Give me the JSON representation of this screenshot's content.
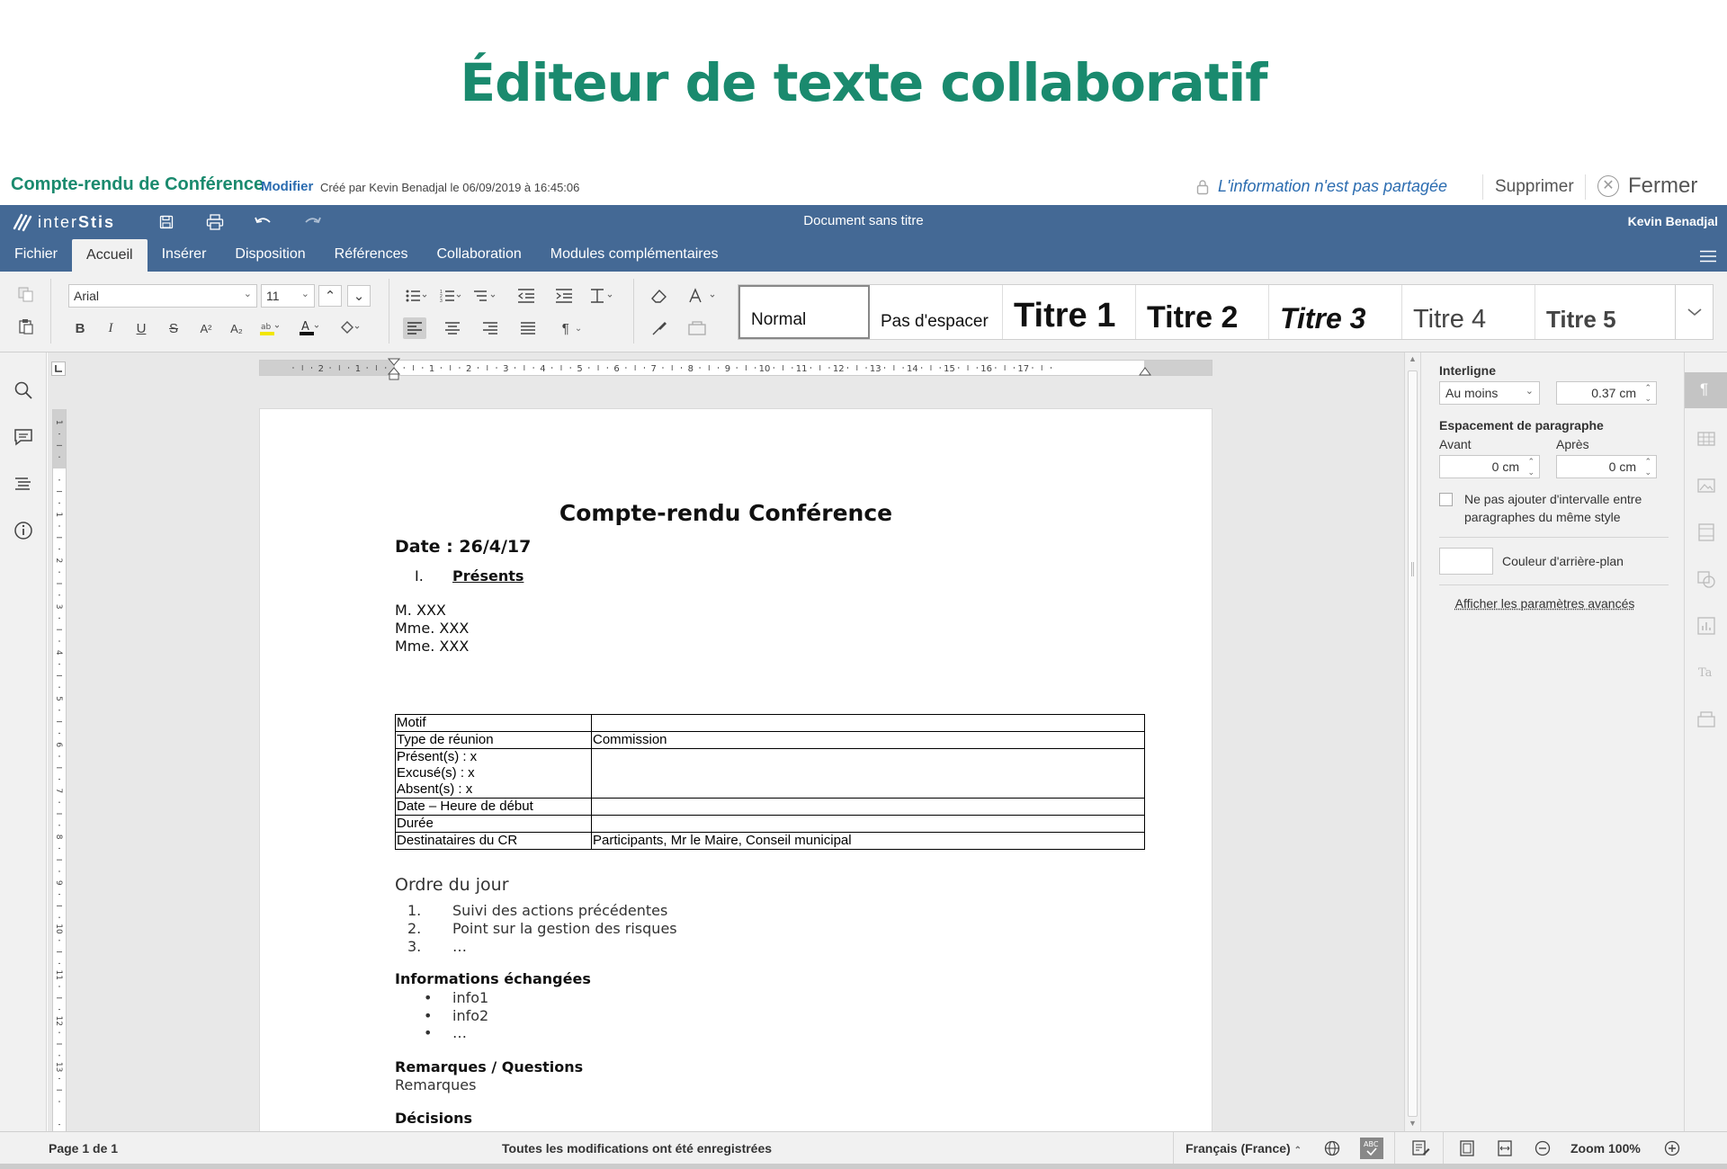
{
  "banner": {
    "title": "Éditeur de texte collaboratif"
  },
  "docbar": {
    "title": "Compte-rendu de Conférence",
    "edit_label": "Modifier",
    "created": "Créé par Kevin Benadjal le 06/09/2019 à 16:45:06",
    "sharing": "L'information n'est pas partagée",
    "delete_label": "Supprimer",
    "close_label": "Fermer"
  },
  "header": {
    "brand_prefix": "inter",
    "brand_suffix": "Stis",
    "doc_name": "Document sans titre",
    "user": "Kevin Benadjal",
    "tabs": [
      {
        "label": "Fichier"
      },
      {
        "label": "Accueil"
      },
      {
        "label": "Insérer"
      },
      {
        "label": "Disposition"
      },
      {
        "label": "Références"
      },
      {
        "label": "Collaboration"
      },
      {
        "label": "Modules complémentaires"
      }
    ]
  },
  "toolbar": {
    "font_family": "Arial",
    "font_size": "11",
    "styles": [
      {
        "label": "Normal"
      },
      {
        "label": "Pas d'espacer"
      },
      {
        "label": "Titre 1"
      },
      {
        "label": "Titre 2"
      },
      {
        "label": "Titre 3"
      },
      {
        "label": "Titre 4"
      },
      {
        "label": "Titre 5"
      }
    ]
  },
  "ruler": {
    "h_labels": [
      "2",
      "1",
      "1",
      "2",
      "3",
      "4",
      "5",
      "6",
      "7",
      "8",
      "9",
      "10",
      "11",
      "12",
      "13",
      "14",
      "15",
      "16",
      "17"
    ],
    "v_labels": [
      "1",
      "1",
      "2",
      "3",
      "4",
      "5",
      "6",
      "7",
      "8",
      "9",
      "10",
      "11",
      "12",
      "13"
    ]
  },
  "document": {
    "title": "Compte-rendu Conférence",
    "date": "Date :  26/4/17",
    "section1_num": "I.",
    "section1": "Présents",
    "attendees": [
      "M. XXX",
      "Mme. XXX",
      "Mme. XXX"
    ],
    "table": [
      {
        "label": "Motif",
        "value": ""
      },
      {
        "label": "Type de réunion",
        "value": "Commission"
      },
      {
        "label": "Présent(s) : x\nExcusé(s) : x\nAbsent(s) : x",
        "value": ""
      },
      {
        "label": "Date – Heure de début",
        "value": ""
      },
      {
        "label": "Durée",
        "value": ""
      },
      {
        "label": "Destinataires du CR",
        "value": "Participants, Mr le Maire, Conseil municipal"
      }
    ],
    "agenda_title": "Ordre du jour",
    "agenda": [
      {
        "num": "1.",
        "text": "Suivi des actions précédentes"
      },
      {
        "num": "2.",
        "text": "Point sur la gestion des risques"
      },
      {
        "num": "3.",
        "text": "…"
      }
    ],
    "info_title": "Informations échangées",
    "info": [
      "info1",
      "info2",
      "…"
    ],
    "remarks_title": "Remarques / Questions",
    "remarks": "Remarques",
    "decisions_title": "Décisions"
  },
  "panel": {
    "line_spacing_label": "Interligne",
    "line_spacing_mode": "Au moins",
    "line_spacing_value": "0.37 cm",
    "para_spacing_label": "Espacement de paragraphe",
    "before_label": "Avant",
    "after_label": "Après",
    "before_value": "0 cm",
    "after_value": "0 cm",
    "no_interval_label": "Ne pas ajouter d'intervalle entre paragraphes du même style",
    "no_interval_checked": false,
    "bg_color_label": "Couleur d'arrière-plan",
    "advanced_label": "Afficher les paramètres avancés"
  },
  "status": {
    "page": "Page 1 de 1",
    "saved": "Toutes les modifications ont été enregistrées",
    "language": "Français (France)",
    "zoom": "Zoom 100%"
  },
  "colors": {
    "brand_green": "#1a8a6e",
    "header_blue": "#446995",
    "link_blue": "#2b6cb0"
  }
}
